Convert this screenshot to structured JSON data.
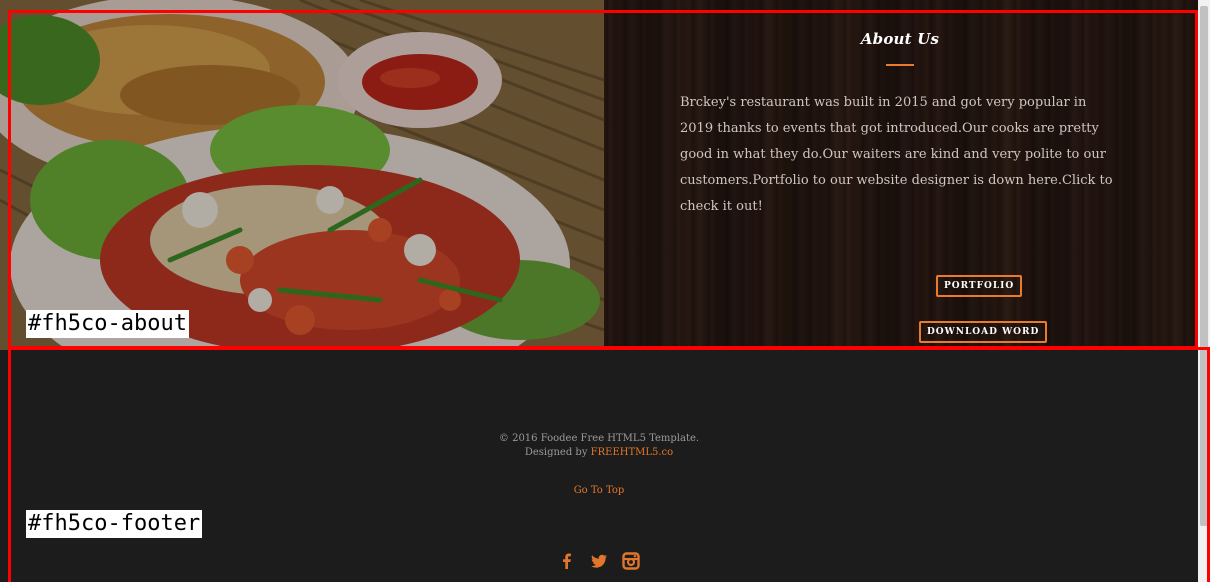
{
  "about": {
    "heading": "About Us",
    "paragraph": "Brckey's restaurant was built in 2015 and got very popular in 2019 thanks to events that got introduced.Our cooks are pretty good in what they do.Our waiters are kind and very polite to our customers.Portfolio to our website designer is down here.Click to check it out!",
    "buttons": {
      "portfolio": "PORTFOLIO",
      "download": "DOWNLOAD WORD"
    },
    "accent_color": "#e87b2c"
  },
  "footer": {
    "copyright_line1": "© 2016 Foodee Free HTML5 Template.",
    "designed_by_prefix": "Designed by",
    "designed_by_link": "FREEHTML5.co",
    "go_to_top": "Go To Top",
    "social_icons": [
      "facebook-icon",
      "twitter-icon",
      "instagram-icon"
    ],
    "link_color": "#e2762a"
  },
  "debug_labels": {
    "about": "#fh5co-about",
    "footer": "#fh5co-footer"
  }
}
